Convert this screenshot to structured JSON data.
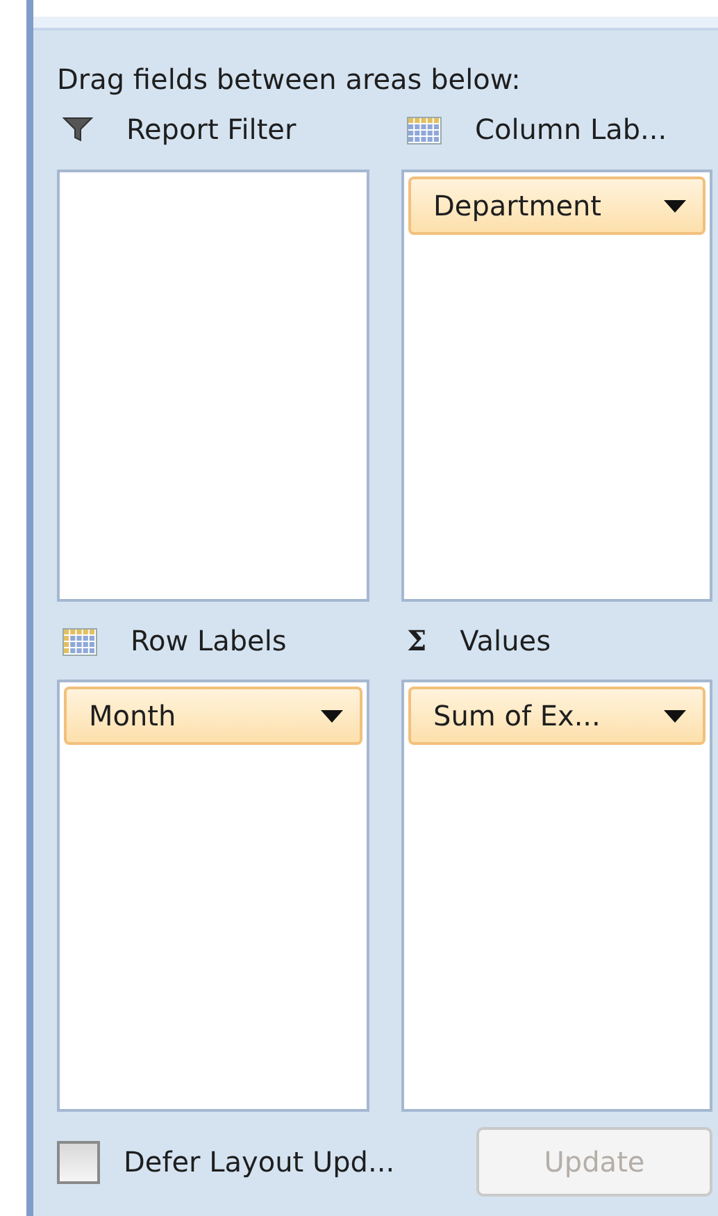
{
  "instruction": "Drag fields between areas below:",
  "areas": [
    {
      "kind": "filter",
      "label": "Report Filter"
    },
    {
      "kind": "columns",
      "label": "Column Lab...",
      "fields": [
        {
          "label": "Department"
        }
      ]
    },
    {
      "kind": "rows",
      "label": "Row Labels",
      "fields": [
        {
          "label": "Month"
        }
      ]
    },
    {
      "kind": "values",
      "symbol": "Σ",
      "label": "Values",
      "fields": [
        {
          "label": "Sum of Ex..."
        }
      ]
    }
  ],
  "defer": {
    "label": "Defer Layout Upd...",
    "checked": false
  },
  "update_button": {
    "label": "Update",
    "disabled": true
  }
}
